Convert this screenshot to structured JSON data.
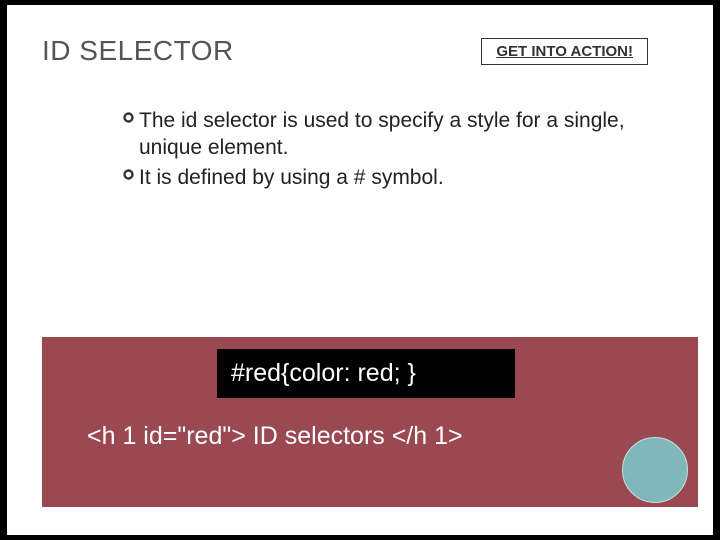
{
  "header": {
    "title": "ID SELECTOR",
    "action_label": "GET INTO ACTION!"
  },
  "bullets": [
    "The id selector is used to specify a style for a single, unique element.",
    "It is defined by using a # symbol."
  ],
  "code": {
    "css_line": "#red{color: red; }",
    "html_line": "<h 1 id=\"red\">  ID selectors </h 1>"
  }
}
